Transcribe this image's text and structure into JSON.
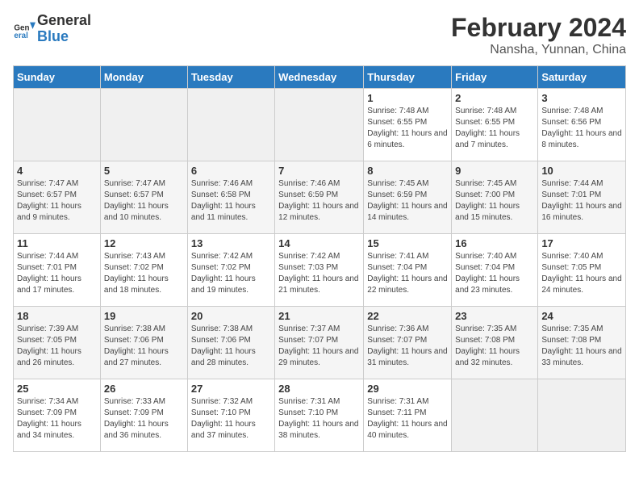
{
  "header": {
    "logo_line1": "General",
    "logo_line2": "Blue",
    "month_year": "February 2024",
    "location": "Nansha, Yunnan, China"
  },
  "days_of_week": [
    "Sunday",
    "Monday",
    "Tuesday",
    "Wednesday",
    "Thursday",
    "Friday",
    "Saturday"
  ],
  "weeks": [
    [
      {
        "day": "",
        "info": ""
      },
      {
        "day": "",
        "info": ""
      },
      {
        "day": "",
        "info": ""
      },
      {
        "day": "",
        "info": ""
      },
      {
        "day": "1",
        "info": "Sunrise: 7:48 AM\nSunset: 6:55 PM\nDaylight: 11 hours and 6 minutes."
      },
      {
        "day": "2",
        "info": "Sunrise: 7:48 AM\nSunset: 6:55 PM\nDaylight: 11 hours and 7 minutes."
      },
      {
        "day": "3",
        "info": "Sunrise: 7:48 AM\nSunset: 6:56 PM\nDaylight: 11 hours and 8 minutes."
      }
    ],
    [
      {
        "day": "4",
        "info": "Sunrise: 7:47 AM\nSunset: 6:57 PM\nDaylight: 11 hours and 9 minutes."
      },
      {
        "day": "5",
        "info": "Sunrise: 7:47 AM\nSunset: 6:57 PM\nDaylight: 11 hours and 10 minutes."
      },
      {
        "day": "6",
        "info": "Sunrise: 7:46 AM\nSunset: 6:58 PM\nDaylight: 11 hours and 11 minutes."
      },
      {
        "day": "7",
        "info": "Sunrise: 7:46 AM\nSunset: 6:59 PM\nDaylight: 11 hours and 12 minutes."
      },
      {
        "day": "8",
        "info": "Sunrise: 7:45 AM\nSunset: 6:59 PM\nDaylight: 11 hours and 14 minutes."
      },
      {
        "day": "9",
        "info": "Sunrise: 7:45 AM\nSunset: 7:00 PM\nDaylight: 11 hours and 15 minutes."
      },
      {
        "day": "10",
        "info": "Sunrise: 7:44 AM\nSunset: 7:01 PM\nDaylight: 11 hours and 16 minutes."
      }
    ],
    [
      {
        "day": "11",
        "info": "Sunrise: 7:44 AM\nSunset: 7:01 PM\nDaylight: 11 hours and 17 minutes."
      },
      {
        "day": "12",
        "info": "Sunrise: 7:43 AM\nSunset: 7:02 PM\nDaylight: 11 hours and 18 minutes."
      },
      {
        "day": "13",
        "info": "Sunrise: 7:42 AM\nSunset: 7:02 PM\nDaylight: 11 hours and 19 minutes."
      },
      {
        "day": "14",
        "info": "Sunrise: 7:42 AM\nSunset: 7:03 PM\nDaylight: 11 hours and 21 minutes."
      },
      {
        "day": "15",
        "info": "Sunrise: 7:41 AM\nSunset: 7:04 PM\nDaylight: 11 hours and 22 minutes."
      },
      {
        "day": "16",
        "info": "Sunrise: 7:40 AM\nSunset: 7:04 PM\nDaylight: 11 hours and 23 minutes."
      },
      {
        "day": "17",
        "info": "Sunrise: 7:40 AM\nSunset: 7:05 PM\nDaylight: 11 hours and 24 minutes."
      }
    ],
    [
      {
        "day": "18",
        "info": "Sunrise: 7:39 AM\nSunset: 7:05 PM\nDaylight: 11 hours and 26 minutes."
      },
      {
        "day": "19",
        "info": "Sunrise: 7:38 AM\nSunset: 7:06 PM\nDaylight: 11 hours and 27 minutes."
      },
      {
        "day": "20",
        "info": "Sunrise: 7:38 AM\nSunset: 7:06 PM\nDaylight: 11 hours and 28 minutes."
      },
      {
        "day": "21",
        "info": "Sunrise: 7:37 AM\nSunset: 7:07 PM\nDaylight: 11 hours and 29 minutes."
      },
      {
        "day": "22",
        "info": "Sunrise: 7:36 AM\nSunset: 7:07 PM\nDaylight: 11 hours and 31 minutes."
      },
      {
        "day": "23",
        "info": "Sunrise: 7:35 AM\nSunset: 7:08 PM\nDaylight: 11 hours and 32 minutes."
      },
      {
        "day": "24",
        "info": "Sunrise: 7:35 AM\nSunset: 7:08 PM\nDaylight: 11 hours and 33 minutes."
      }
    ],
    [
      {
        "day": "25",
        "info": "Sunrise: 7:34 AM\nSunset: 7:09 PM\nDaylight: 11 hours and 34 minutes."
      },
      {
        "day": "26",
        "info": "Sunrise: 7:33 AM\nSunset: 7:09 PM\nDaylight: 11 hours and 36 minutes."
      },
      {
        "day": "27",
        "info": "Sunrise: 7:32 AM\nSunset: 7:10 PM\nDaylight: 11 hours and 37 minutes."
      },
      {
        "day": "28",
        "info": "Sunrise: 7:31 AM\nSunset: 7:10 PM\nDaylight: 11 hours and 38 minutes."
      },
      {
        "day": "29",
        "info": "Sunrise: 7:31 AM\nSunset: 7:11 PM\nDaylight: 11 hours and 40 minutes."
      },
      {
        "day": "",
        "info": ""
      },
      {
        "day": "",
        "info": ""
      }
    ]
  ]
}
